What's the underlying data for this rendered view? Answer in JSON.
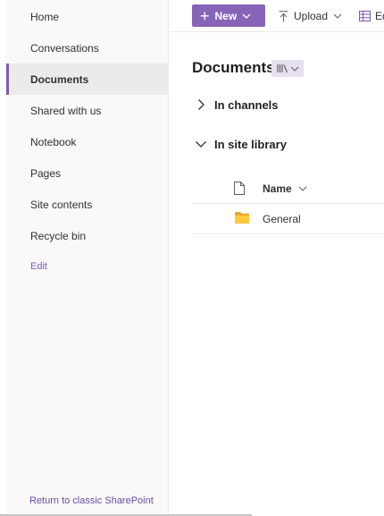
{
  "nav": {
    "items": [
      {
        "label": "Home",
        "selected": false
      },
      {
        "label": "Conversations",
        "selected": false
      },
      {
        "label": "Documents",
        "selected": true
      },
      {
        "label": "Shared with us",
        "selected": false
      },
      {
        "label": "Notebook",
        "selected": false
      },
      {
        "label": "Pages",
        "selected": false
      },
      {
        "label": "Site contents",
        "selected": false
      },
      {
        "label": "Recycle bin",
        "selected": false
      }
    ],
    "edit_label": "Edit",
    "classic_label": "Return to classic SharePoint"
  },
  "commandbar": {
    "new_label": "New",
    "upload_label": "Upload",
    "edit_grid_label": "Ed",
    "accent_color": "#8764b8"
  },
  "main": {
    "title": "Documents",
    "groups": [
      {
        "label": "In channels",
        "expanded": false
      },
      {
        "label": "In site library",
        "expanded": true
      }
    ],
    "columns": {
      "name": "Name"
    },
    "files": [
      {
        "name": "General",
        "type": "folder"
      }
    ]
  },
  "icons": {
    "view": "library-view-icon",
    "file_type": "document-icon",
    "folder": "folder-icon"
  }
}
